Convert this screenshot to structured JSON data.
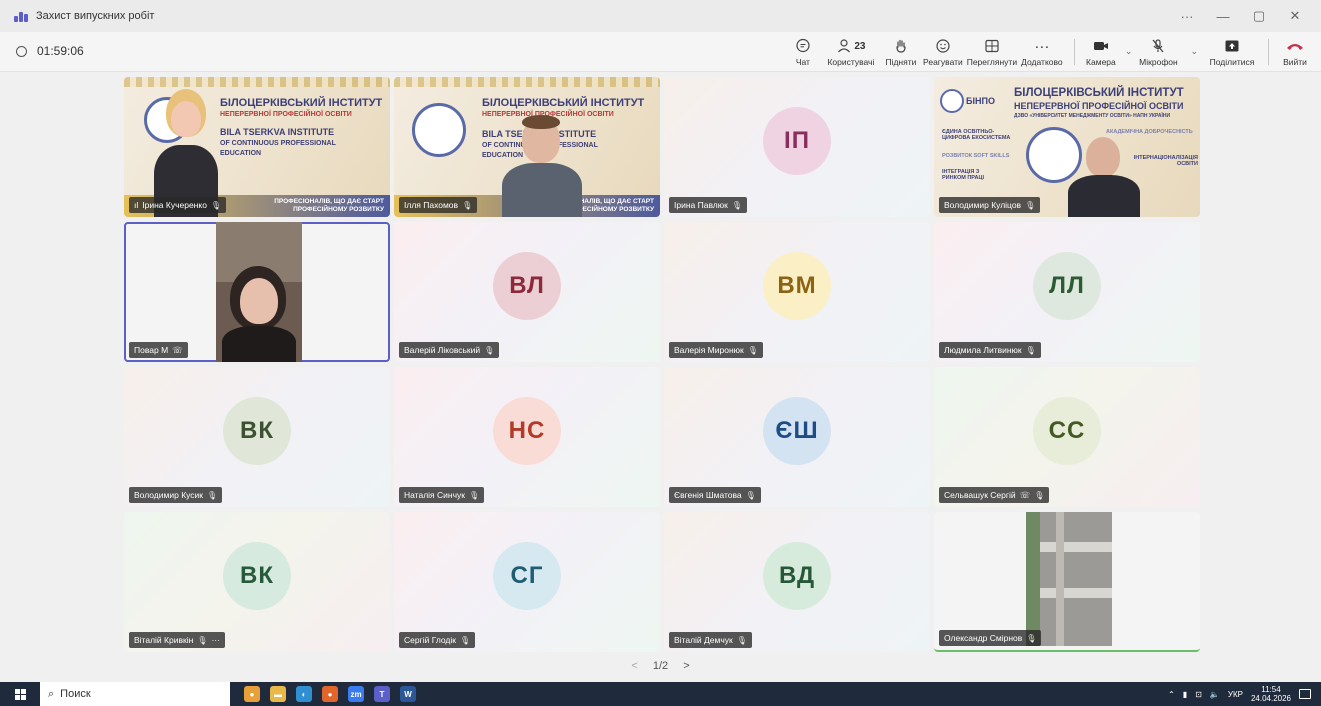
{
  "window": {
    "title": "Захист випускних робіт",
    "controls": [
      "···",
      "—",
      "▢",
      "✕"
    ]
  },
  "meeting": {
    "timer": "01:59:06",
    "toolbar": [
      {
        "icon": "chat-icon",
        "glyph": "💬",
        "label": "Чат"
      },
      {
        "icon": "people-icon",
        "glyph": "👥",
        "label": "Користувачі",
        "count": "23"
      },
      {
        "icon": "raise-hand-icon",
        "glyph": "✋",
        "label": "Підняти"
      },
      {
        "icon": "react-icon",
        "glyph": "☺",
        "label": "Реагувати"
      },
      {
        "icon": "view-icon",
        "glyph": "⊞",
        "label": "Переглянути"
      },
      {
        "icon": "more-icon",
        "glyph": "···",
        "label": "Додатково"
      },
      {
        "icon": "camera-icon",
        "glyph": "■",
        "label": "Камера"
      },
      {
        "icon": "mic-off-icon",
        "glyph": "🎙",
        "label": "Мікрофон"
      },
      {
        "icon": "share-icon",
        "glyph": "⬆",
        "label": "Поділитися"
      },
      {
        "icon": "hang-up-icon",
        "glyph": "☎",
        "label": "Вийти"
      }
    ]
  },
  "participants": [
    {
      "name": "Ірина Кучеренко",
      "kind": "video-banner",
      "signal": "ıl"
    },
    {
      "name": "Ілля Пахомов",
      "kind": "video-banner"
    },
    {
      "name": "Ірина Павлюк",
      "kind": "avatar",
      "initials": "ІП",
      "bg": "#efd3e3",
      "fg": "#8a2d5c"
    },
    {
      "name": "Володимир Куліцов",
      "kind": "video-banner"
    },
    {
      "name": "Повар М",
      "kind": "video-phone",
      "speaking": true
    },
    {
      "name": "Валерій Ліковський",
      "kind": "avatar",
      "initials": "ВЛ",
      "bg": "#eccfd4",
      "fg": "#8c2a3a"
    },
    {
      "name": "Валерія Миронюк",
      "kind": "avatar",
      "initials": "ВМ",
      "bg": "#fbefc6",
      "fg": "#8a6412"
    },
    {
      "name": "Людмила Литвинюк",
      "kind": "avatar",
      "initials": "ЛЛ",
      "bg": "#dfe8df",
      "fg": "#2c5a33"
    },
    {
      "name": "Володимир Кусик",
      "kind": "avatar",
      "initials": "ВК",
      "bg": "#e0e6d8",
      "fg": "#3a5230"
    },
    {
      "name": "Наталія Синчук",
      "kind": "avatar",
      "initials": "НС",
      "bg": "#f9dcd6",
      "fg": "#b23a2a"
    },
    {
      "name": "Євгенія Шматова",
      "kind": "avatar",
      "initials": "ЄШ",
      "bg": "#d4e3f2",
      "fg": "#1c4d85"
    },
    {
      "name": "Сельвашук Сергій",
      "kind": "avatar",
      "initials": "СС",
      "bg": "#e7edd8",
      "fg": "#455a22"
    },
    {
      "name": "Віталій Кривкін",
      "kind": "avatar",
      "initials": "ВК",
      "bg": "#d6eadf",
      "fg": "#275a3b",
      "extra": "···"
    },
    {
      "name": "Сергій Глодік",
      "kind": "avatar",
      "initials": "СГ",
      "bg": "#d6e9f0",
      "fg": "#205d73"
    },
    {
      "name": "Віталій Демчук",
      "kind": "avatar",
      "initials": "ВД",
      "bg": "#d7ebdd",
      "fg": "#265838"
    },
    {
      "name": "Олександр Смірнов",
      "kind": "video-room"
    }
  ],
  "banner": {
    "title_ua_1": "БІЛОЦЕРКІВСЬКИЙ ІНСТИТУТ",
    "title_ua_2": "НЕПЕРЕРВНОЇ ПРОФЕСІЙНОЇ ОСВІТИ",
    "title_en_1": "BILA TSERKVA INSTITUTE",
    "title_en_2": "OF CONTINUOUS PROFESSIONAL",
    "title_en_3": "EDUCATION",
    "footer_1": "ПРОФЕСІОНАЛІВ, ЩО ДАЄ СТАРТ",
    "footer_2": "ПРОФЕСІЙНОМУ РОЗВИТКУ",
    "short": "БІНПО",
    "sub_4": "ДЗВО «УНІВЕРСИТЕТ МЕНЕДЖМЕНТУ ОСВІТИ» НАПН УКРАЇНИ",
    "tag_1": "ЄДИНА ОСВІТНЬО-ЦИФРОВА ЕКОСИСТЕМА",
    "tag_2": "РОЗВИТОК SOFT SKILLS",
    "tag_3": "ІНТЕГРАЦІЯ З РИНКОМ ПРАЦІ",
    "tag_4": "АКАДЕМІЧНА ДОБРОЧЕСНІСТЬ",
    "tag_5": "ІНТЕРНАЦІОНАЛІЗАЦІЯ ОСВІТИ"
  },
  "pager": {
    "prev": "<",
    "label": "1/2",
    "next": ">"
  },
  "taskbar": {
    "search_label": "Поиск",
    "apps": [
      {
        "name": "chrome",
        "color": "#e8a13a",
        "glyph": "●"
      },
      {
        "name": "explorer",
        "color": "#e9b84a",
        "glyph": "▬"
      },
      {
        "name": "edge",
        "color": "#2f8fd0",
        "glyph": "◐"
      },
      {
        "name": "firefox",
        "color": "#e0662c",
        "glyph": "●"
      },
      {
        "name": "zoom",
        "color": "#3b7bf0",
        "glyph": "zm"
      },
      {
        "name": "teams",
        "color": "#5b5fc7",
        "glyph": "T"
      },
      {
        "name": "word",
        "color": "#2b5797",
        "glyph": "W"
      }
    ],
    "lang": "УКР",
    "time": "11:54",
    "date": "24.04.2026"
  }
}
